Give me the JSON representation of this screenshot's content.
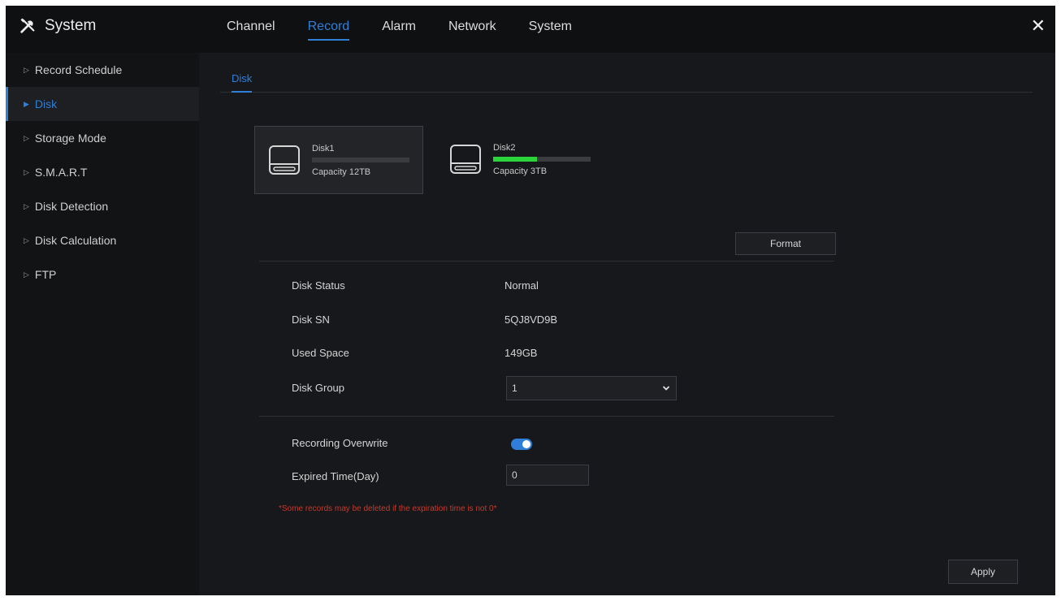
{
  "app": {
    "title": "System",
    "close_symbol": "✕"
  },
  "top_tabs": [
    {
      "label": "Channel",
      "active": false
    },
    {
      "label": "Record",
      "active": true
    },
    {
      "label": "Alarm",
      "active": false
    },
    {
      "label": "Network",
      "active": false
    },
    {
      "label": "System",
      "active": false
    }
  ],
  "sidebar": {
    "items": [
      {
        "label": "Record Schedule",
        "active": false
      },
      {
        "label": "Disk",
        "active": true
      },
      {
        "label": "Storage Mode",
        "active": false
      },
      {
        "label": "S.M.A.R.T",
        "active": false
      },
      {
        "label": "Disk Detection",
        "active": false
      },
      {
        "label": "Disk Calculation",
        "active": false
      },
      {
        "label": "FTP",
        "active": false
      }
    ]
  },
  "subtab": {
    "label": "Disk"
  },
  "disks": [
    {
      "name": "Disk1",
      "capacity_label": "Capacity 12TB",
      "used_fraction": 0.0,
      "selected": true
    },
    {
      "name": "Disk2",
      "capacity_label": "Capacity 3TB",
      "used_fraction": 0.45,
      "selected": false
    }
  ],
  "actions": {
    "format_label": "Format",
    "apply_label": "Apply"
  },
  "details": {
    "status_label": "Disk Status",
    "status_value": "Normal",
    "sn_label": "Disk SN",
    "sn_value": "5QJ8VD9B",
    "used_label": "Used Space",
    "used_value": "149GB",
    "group_label": "Disk Group",
    "group_value": "1"
  },
  "overwrite": {
    "label": "Recording Overwrite",
    "enabled": true,
    "expired_label": "Expired Time(Day)",
    "expired_value": "0",
    "warning": "*Some records may be deleted if the expiration time is not 0*"
  },
  "colors": {
    "accent": "#2f7fd8",
    "bar_fill": "#2bd43a",
    "warning": "#c23a2e",
    "background": "#17181b"
  }
}
